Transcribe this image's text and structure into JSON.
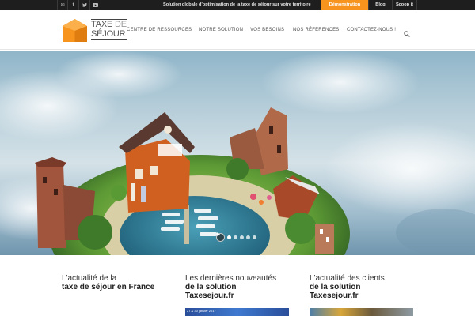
{
  "topbar": {
    "social_icons": [
      "mail-icon",
      "facebook-icon",
      "twitter-icon",
      "youtube-icon"
    ],
    "tagline": "Solution globale d'optimisation de la taxe de séjour sur votre territoire",
    "buttons": {
      "demo": "Démonstration",
      "blog": "Blog",
      "scoop": "Scoop it"
    },
    "colors": {
      "background": "#1e1e1e",
      "accent": "#f7941d"
    }
  },
  "logo": {
    "line1_a": "TAXE",
    "line1_b": "DE",
    "line2": "SÉJOUR",
    "colors": {
      "mark": "#f7941d"
    }
  },
  "nav": {
    "items": [
      "CENTRE DE RESSOURCES",
      "NOTRE SOLUTION",
      "VOS BESOINS",
      "NOS RÉFÉRENCES",
      "CONTACTEZ-NOUS !"
    ],
    "search_icon": "search-icon"
  },
  "hero": {
    "slider": {
      "slides": 5,
      "active": 1
    }
  },
  "sections": [
    {
      "line1": "L'actualité de la",
      "line2": "taxe de séjour en France"
    },
    {
      "line1": "Les dernières nouveautés",
      "line2": "de la solution",
      "line3": "Taxesejour.fr",
      "thumb_date": "27 & 30 janvier 2017"
    },
    {
      "line1": "L'actualité des clients",
      "line2": "de la solution",
      "line3": "Taxesejour.fr"
    }
  ]
}
